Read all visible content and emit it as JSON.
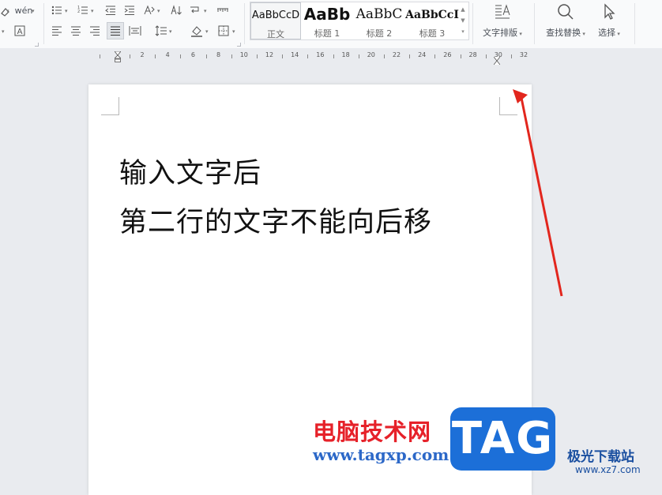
{
  "ribbon": {
    "pinyin_label": "wén",
    "styles": [
      {
        "sample": "AaBbCcD",
        "label": "正文",
        "active": true
      },
      {
        "sample": "AaBb",
        "label": "标题 1",
        "active": false
      },
      {
        "sample": "AaBbC",
        "label": "标题 2",
        "active": false
      },
      {
        "sample": "AaBbCcI",
        "label": "标题 3",
        "active": false
      }
    ],
    "text_layout_label": "文字排版",
    "find_replace_label": "查找替换",
    "select_label": "选择"
  },
  "ruler": {
    "numbers": [
      "2",
      "4",
      "6",
      "8",
      "10",
      "12",
      "14",
      "16",
      "18",
      "20",
      "22",
      "24",
      "26",
      "28",
      "30",
      "32"
    ]
  },
  "document": {
    "lines": [
      "输入文字后",
      "第二行的文字不能向后移"
    ]
  },
  "watermark": {
    "brand_cn": "电脑技术网",
    "url": "www.tagxp.com",
    "tag": "TAG",
    "site_cn": "极光下载站",
    "site_url": "www.xz7.com"
  },
  "colors": {
    "accent_red": "#e62129",
    "tag_blue": "#1c6fd8"
  }
}
